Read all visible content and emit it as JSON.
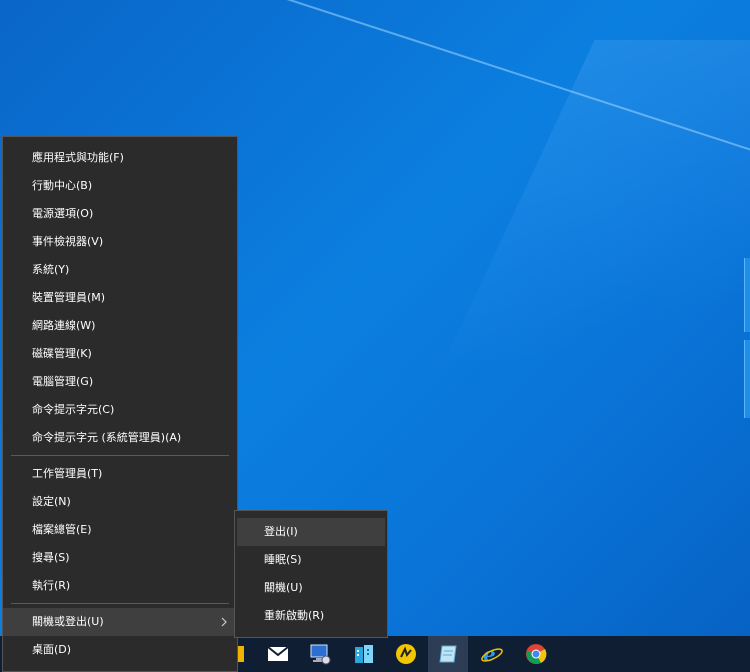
{
  "winx_menu": {
    "group1": [
      "應用程式與功能(F)",
      "行動中心(B)",
      "電源選項(O)",
      "事件檢視器(V)",
      "系統(Y)",
      "裝置管理員(M)",
      "網路連線(W)",
      "磁碟管理(K)",
      "電腦管理(G)",
      "命令提示字元(C)",
      "命令提示字元 (系統管理員)(A)"
    ],
    "group2": [
      "工作管理員(T)",
      "設定(N)",
      "檔案總管(E)",
      "搜尋(S)",
      "執行(R)"
    ],
    "shutdown_item": "關機或登出(U)",
    "desktop_item": "桌面(D)"
  },
  "power_submenu": {
    "items": [
      "登出(I)",
      "睡眠(S)",
      "關機(U)",
      "重新啟動(R)"
    ]
  },
  "taskbar": {
    "icons": [
      "folder-icon",
      "mail-icon",
      "network-computer-icon",
      "building-app-icon",
      "yellow-circle-app-icon",
      "notepad-app-icon",
      "internet-explorer-icon",
      "chrome-icon"
    ]
  },
  "colors": {
    "menu_bg": "#2b2b2b",
    "menu_hover": "#3f3f3f",
    "desktop_blue": "#0b7fe0",
    "taskbar_bg": "#0f1e33"
  }
}
